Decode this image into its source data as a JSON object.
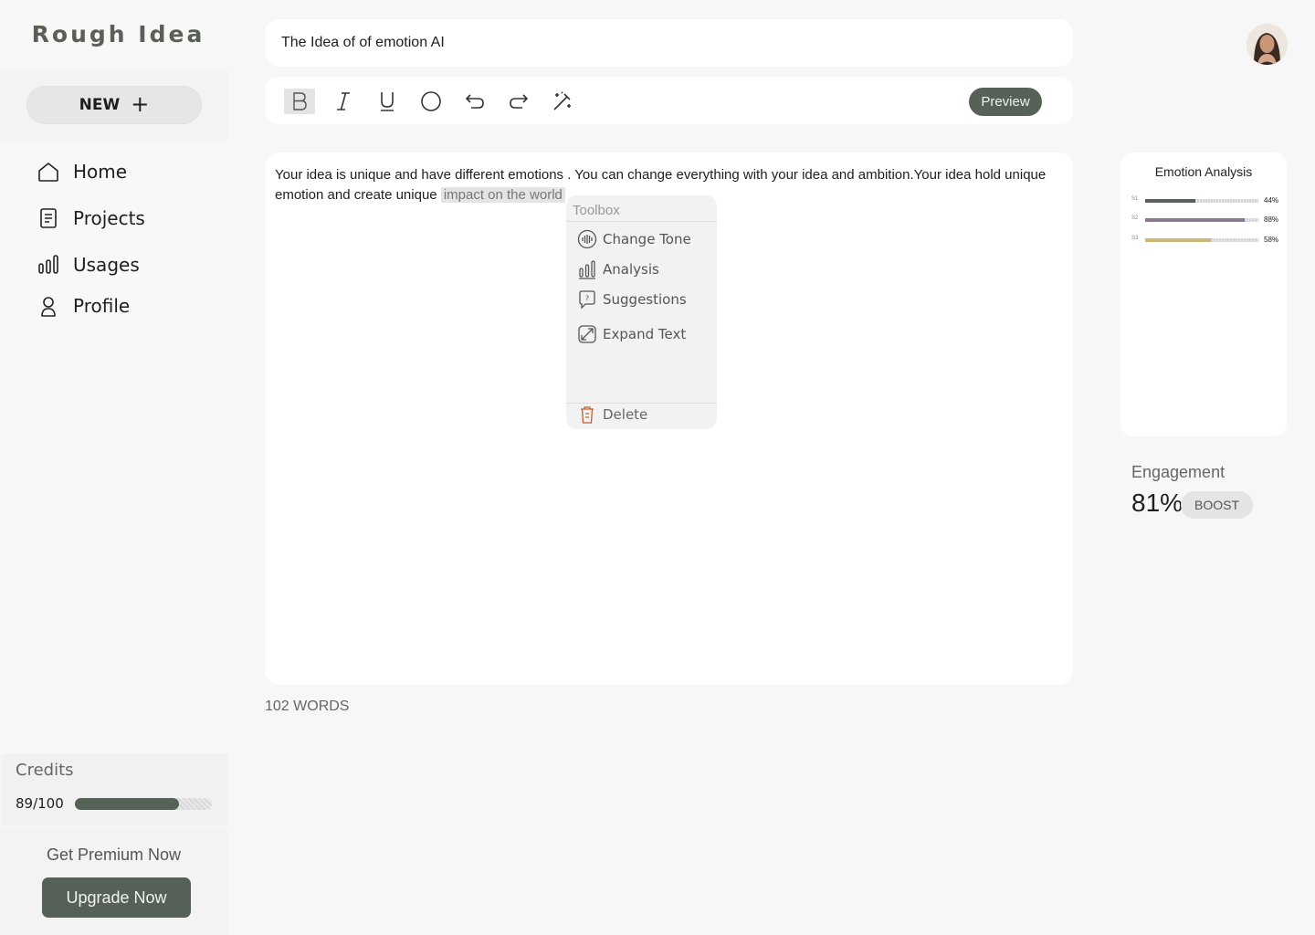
{
  "app": {
    "brand": "Rough Idea"
  },
  "sidebar": {
    "new_label": "NEW",
    "new_icon": "+",
    "items": [
      {
        "label": "Home",
        "icon": "home-icon"
      },
      {
        "label": "Projects",
        "icon": "document-icon"
      },
      {
        "label": "Usages",
        "icon": "bar-chart-icon"
      },
      {
        "label": "Profile",
        "icon": "user-icon"
      }
    ],
    "credits": {
      "title": "Credits",
      "value": "89/100",
      "fraction": 0.76
    },
    "premium": {
      "label": "Get Premium Now",
      "button": "Upgrade Now"
    }
  },
  "editor": {
    "title": "The Idea of  of emotion AI",
    "toolbar": {
      "tools": [
        "bold-icon",
        "italic-icon",
        "underline-icon",
        "circle-icon",
        "undo-icon",
        "redo-icon",
        "magic-wand-icon"
      ],
      "preview": "Preview"
    },
    "text": "Your idea is unique and have different emotions . You can change everything with your idea and ambition.Your idea hold unique emotion and create unique",
    "highlight": "impact on the world",
    "word_count": "102 WORDS"
  },
  "toolbox": {
    "title": "Toolbox",
    "items": [
      {
        "label": "Change Tone",
        "icon": "sound-wave-icon"
      },
      {
        "label": "Analysis",
        "icon": "bar-chart-icon"
      },
      {
        "label": "Suggestions",
        "icon": "question-bubble-icon"
      },
      {
        "label": "Expand  Text",
        "icon": "expand-icon"
      }
    ],
    "delete": {
      "label": "Delete",
      "icon": "trash-icon",
      "color": "#c0622f"
    }
  },
  "emotion_analysis": {
    "title": "Emotion Analysis",
    "rows": [
      {
        "label": "S1",
        "value": "44%",
        "fraction": 0.44,
        "color": "#566157"
      },
      {
        "label": "S2",
        "value": "88%",
        "fraction": 0.88,
        "color": "#8a7a90"
      },
      {
        "label": "S3",
        "value": "58%",
        "fraction": 0.58,
        "color": "#cdb877"
      }
    ]
  },
  "engagement": {
    "label": "Engagement",
    "value": "81%",
    "button": "BOOST"
  },
  "colors": {
    "accent": "#566157",
    "background": "#f7f7f7"
  }
}
